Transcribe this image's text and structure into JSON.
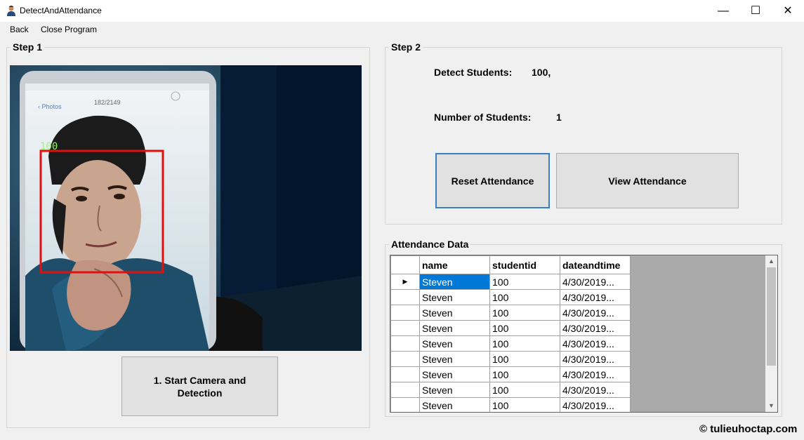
{
  "window": {
    "title": "DetectAndAttendance",
    "minimize_glyph": "—",
    "maximize_glyph": "☐",
    "close_glyph": "✕"
  },
  "menu": {
    "items": [
      "Back",
      "Close Program"
    ]
  },
  "step1": {
    "label": "Step 1",
    "camera": {
      "detection_label": "100"
    },
    "start_button": "1. Start Camera and Detection"
  },
  "step2": {
    "label": "Step 2",
    "detect_students_label": "Detect Students:",
    "detect_students_value": "100,",
    "number_of_students_label": "Number of Students:",
    "number_of_students_value": "1",
    "reset_button": "Reset Attendance",
    "view_button": "View Attendance"
  },
  "attendance": {
    "label": "Attendance Data",
    "columns": [
      "name",
      "studentid",
      "dateandtime"
    ],
    "row_indicator": "▶",
    "rows": [
      [
        "Steven",
        "100",
        "4/30/2019..."
      ],
      [
        "Steven",
        "100",
        "4/30/2019..."
      ],
      [
        "Steven",
        "100",
        "4/30/2019..."
      ],
      [
        "Steven",
        "100",
        "4/30/2019..."
      ],
      [
        "Steven",
        "100",
        "4/30/2019..."
      ],
      [
        "Steven",
        "100",
        "4/30/2019..."
      ],
      [
        "Steven",
        "100",
        "4/30/2019..."
      ],
      [
        "Steven",
        "100",
        "4/30/2019..."
      ],
      [
        "Steven",
        "100",
        "4/30/2019..."
      ]
    ],
    "scroll_up": "▲",
    "scroll_down": "▼"
  },
  "watermark": "© tulieuhoctap.com",
  "colors": {
    "selection": "#0078d7",
    "detection_box": "#e01010",
    "detection_text": "#90ff60",
    "focus_border": "#3a7fc6"
  }
}
